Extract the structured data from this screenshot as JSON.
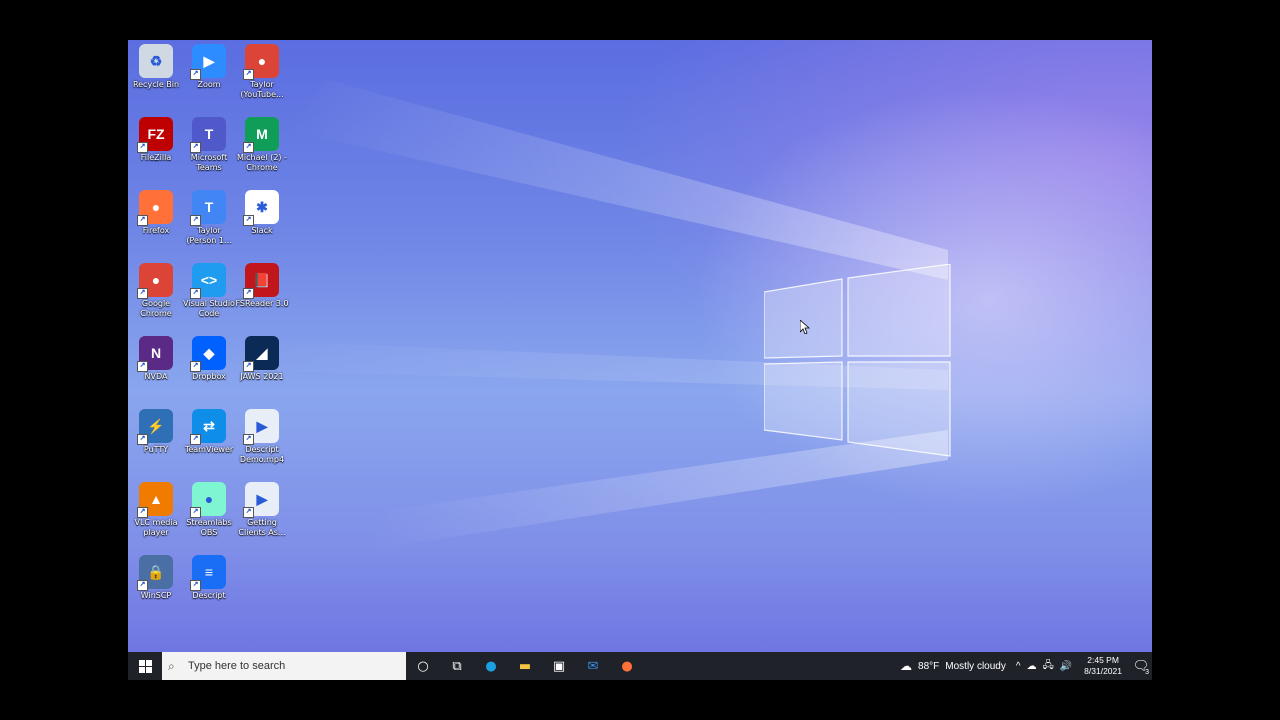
{
  "desktop": {
    "icons": [
      {
        "label": "Recycle Bin",
        "icon": "recycle-bin-icon",
        "color": "#cfd8e3",
        "glyph": "♻"
      },
      {
        "label": "Zoom",
        "icon": "zoom-icon",
        "color": "#2d8cff",
        "glyph": "▶"
      },
      {
        "label": "Taylor\n(YouTube...",
        "icon": "chrome-profile-icon",
        "color": "#db4437",
        "glyph": "●"
      },
      {
        "label": "FileZilla",
        "icon": "filezilla-icon",
        "color": "#bf0000",
        "glyph": "FZ"
      },
      {
        "label": "Microsoft\nTeams",
        "icon": "teams-icon",
        "color": "#5059c9",
        "glyph": "T"
      },
      {
        "label": "Michael (2) -\nChrome",
        "icon": "chrome-profile-icon",
        "color": "#0f9d58",
        "glyph": "M"
      },
      {
        "label": "Firefox",
        "icon": "firefox-icon",
        "color": "#ff7139",
        "glyph": "●"
      },
      {
        "label": "Taylor\n(Person 1...",
        "icon": "chrome-profile-icon",
        "color": "#4285f4",
        "glyph": "T"
      },
      {
        "label": "Slack",
        "icon": "slack-icon",
        "color": "#ffffff",
        "glyph": "✱"
      },
      {
        "label": "Google\nChrome",
        "icon": "chrome-icon",
        "color": "#db4437",
        "glyph": "●"
      },
      {
        "label": "Visual Studio\nCode",
        "icon": "vscode-icon",
        "color": "#1f9cf0",
        "glyph": "<>"
      },
      {
        "label": "FSReader 3.0",
        "icon": "fsreader-icon",
        "color": "#c0161c",
        "glyph": "📕"
      },
      {
        "label": "NVDA",
        "icon": "nvda-icon",
        "color": "#5b2a86",
        "glyph": "N"
      },
      {
        "label": "Dropbox",
        "icon": "dropbox-icon",
        "color": "#0061fe",
        "glyph": "◆"
      },
      {
        "label": "JAWS 2021",
        "icon": "jaws-icon",
        "color": "#0b2a55",
        "glyph": "◢"
      },
      {
        "label": "PuTTY",
        "icon": "putty-icon",
        "color": "#2e6fb5",
        "glyph": "⚡"
      },
      {
        "label": "TeamViewer",
        "icon": "teamviewer-icon",
        "color": "#0e8ee9",
        "glyph": "⇄"
      },
      {
        "label": "Descript\nDemo.mp4",
        "icon": "video-file-icon",
        "color": "#e8eef7",
        "glyph": "▶"
      },
      {
        "label": "VLC media\nplayer",
        "icon": "vlc-icon",
        "color": "#f07b00",
        "glyph": "▲"
      },
      {
        "label": "Streamlabs\nOBS",
        "icon": "streamlabs-icon",
        "color": "#80f5d2",
        "glyph": "●"
      },
      {
        "label": "Getting\nClients As...",
        "icon": "video-file-icon",
        "color": "#e8eef7",
        "glyph": "▶"
      },
      {
        "label": "WinSCP",
        "icon": "winscp-icon",
        "color": "#4a6fa5",
        "glyph": "🔒"
      },
      {
        "label": "Descript",
        "icon": "descript-icon",
        "color": "#1a6ef5",
        "glyph": "≡"
      }
    ]
  },
  "taskbar": {
    "search_placeholder": "Type here to search",
    "pinned": [
      {
        "name": "cortana-icon",
        "glyph": "○"
      },
      {
        "name": "task-view-icon",
        "glyph": "⧉"
      },
      {
        "name": "edge-icon",
        "glyph": "●"
      },
      {
        "name": "file-explorer-icon",
        "glyph": "▬"
      },
      {
        "name": "store-icon",
        "glyph": "▣"
      },
      {
        "name": "mail-icon",
        "glyph": "✉"
      },
      {
        "name": "firefox-icon",
        "glyph": "●"
      }
    ],
    "weather_temp": "88°F",
    "weather_desc": "Mostly cloudy",
    "time": "2:45 PM",
    "date": "8/31/2021",
    "notification_count": "3"
  },
  "colors": {
    "taskbar": "#1f2329",
    "edge": "#1ba1e2",
    "explorer": "#f4c542",
    "store": "#ffffff",
    "mail": "#3a8ee6",
    "firefox": "#ff7139"
  }
}
